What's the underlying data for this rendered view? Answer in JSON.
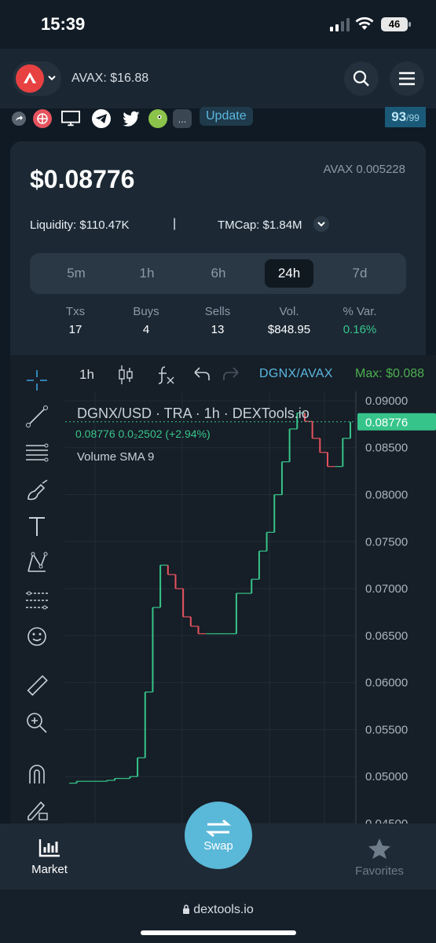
{
  "status_bar": {
    "time": "15:39",
    "battery": "46"
  },
  "header": {
    "avax_price": "AVAX: $16.88"
  },
  "social": {
    "more": "...",
    "update_label": "Update",
    "score": "93",
    "score_max": "/99"
  },
  "token": {
    "price": "$0.08776",
    "pair_price": "AVAX 0.005228",
    "liquidity": "Liquidity: $110.47K",
    "separator": "|",
    "tmcap": "TMCap: $1.84M"
  },
  "timeframes": [
    "5m",
    "1h",
    "6h",
    "24h",
    "7d"
  ],
  "active_timeframe": "24h",
  "stats": [
    {
      "label": "Txs",
      "value": "17"
    },
    {
      "label": "Buys",
      "value": "4"
    },
    {
      "label": "Sells",
      "value": "13"
    },
    {
      "label": "Vol.",
      "value": "$848.95"
    },
    {
      "label": "% Var.",
      "value": "0.16%"
    }
  ],
  "chart_toolbar": {
    "interval": "1h",
    "pair": "DGNX/AVAX",
    "max": "Max: $0.088"
  },
  "chart_legend": {
    "title": "DGNX/USD · TRA · 1h · DEXTools.io",
    "ohlc": "0.08776  0.0₂2502 (+2.94%)",
    "indicator": "Volume SMA 9"
  },
  "chart_data": {
    "type": "line",
    "title": "DGNX/USD · TRA · 1h · DEXTools.io",
    "ylim": [
      0.045,
      0.091
    ],
    "y_ticks": [
      "0.09000",
      "0.08500",
      "0.08000",
      "0.07500",
      "0.07000",
      "0.06500",
      "0.06000",
      "0.05500",
      "0.05000",
      "0.04500"
    ],
    "y_tick_values": [
      0.09,
      0.085,
      0.08,
      0.075,
      0.07,
      0.065,
      0.06,
      0.055,
      0.05,
      0.045
    ],
    "last_price_label": "0.08776",
    "last_price": 0.08776,
    "series": [
      {
        "values": [
          0.0493,
          0.0495,
          0.0495,
          0.0495,
          0.0495,
          0.0496,
          0.0498,
          0.0498,
          0.05,
          0.052,
          0.059,
          0.068,
          0.0725,
          0.0715,
          0.07,
          0.067,
          0.066,
          0.0652,
          0.0652,
          0.0652,
          0.0652,
          0.0652,
          0.0695,
          0.0695,
          0.071,
          0.074,
          0.076,
          0.08,
          0.0835,
          0.087,
          0.0887,
          0.0878,
          0.086,
          0.0845,
          0.083,
          0.083,
          0.086,
          0.08776
        ]
      }
    ]
  },
  "bottom_nav": {
    "market": "Market",
    "swap": "Swap",
    "favorites": "Favorites"
  },
  "browser": {
    "url": "dextools.io"
  },
  "colors": {
    "accent": "#5ab8d8",
    "up": "#37c48a",
    "down": "#e5535e",
    "bg": "#161e27"
  }
}
